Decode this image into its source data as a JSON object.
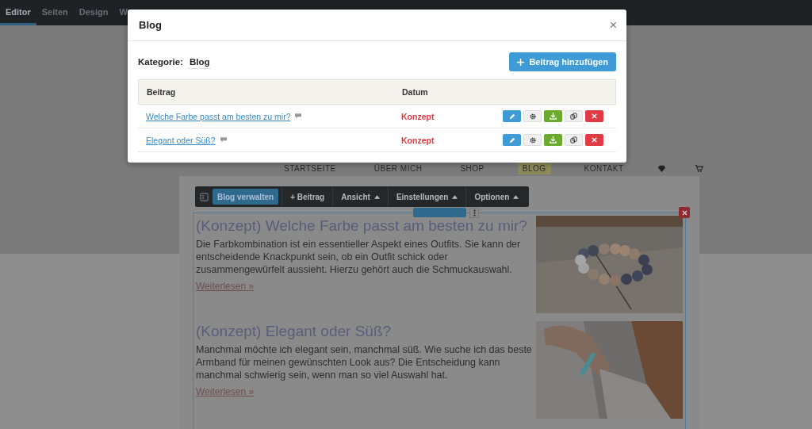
{
  "top_tabs": [
    {
      "label": "Editor",
      "selected": true
    },
    {
      "label": "Seiten",
      "selected": false
    },
    {
      "label": "Design",
      "selected": false
    },
    {
      "label": "W",
      "selected": false
    }
  ],
  "modal": {
    "title": "Blog",
    "close": "×",
    "category_label": "Kategorie:",
    "category_value": "Blog",
    "add_button": "Beitrag hinzufügen",
    "columns": [
      "Beitrag",
      "Datum"
    ],
    "rows": [
      {
        "title": "Welche Farbe passt am besten zu mir?",
        "status": "Konzept"
      },
      {
        "title": "Elegant oder Süß?",
        "status": "Konzept"
      }
    ]
  },
  "site_nav": [
    {
      "label": "STARTSEITE",
      "selected": false
    },
    {
      "label": "ÜBER MICH",
      "selected": false
    },
    {
      "label": "SHOP",
      "selected": false
    },
    {
      "label": "BLOG",
      "selected": true
    },
    {
      "label": "KONTAKT",
      "selected": false
    }
  ],
  "toolbar": [
    {
      "label": "Blog verwalten",
      "kind": "primary"
    },
    {
      "label": "+ Beitrag",
      "kind": "plain"
    },
    {
      "label": "Ansicht",
      "kind": "dropdown"
    },
    {
      "label": "Einstellungen",
      "kind": "dropdown"
    },
    {
      "label": "Optionen",
      "kind": "dropdown"
    }
  ],
  "posts": [
    {
      "title": "(Konzept) Welche Farbe passt am besten zu mir?",
      "excerpt": "Die Farbkombination ist ein essentieller Aspekt eines Outfits. Sie kann der entscheidende Knackpunkt sein, ob ein Outfit schick oder zusammengewürfelt aussieht. Hierzu gehört auch die Schmuckauswahl.",
      "link": "Weiterlesen »"
    },
    {
      "title": "(Konzept) Elegant oder Süß?",
      "excerpt": "Manchmal möchte ich elegant sein, manchmal süß. Wie suche ich das beste Armband für meinen gewünschten Look aus? Die Entscheidung kann manchmal schwierig sein, wenn man so viel Auswahl hat.",
      "link": "Weiterlesen »"
    }
  ]
}
